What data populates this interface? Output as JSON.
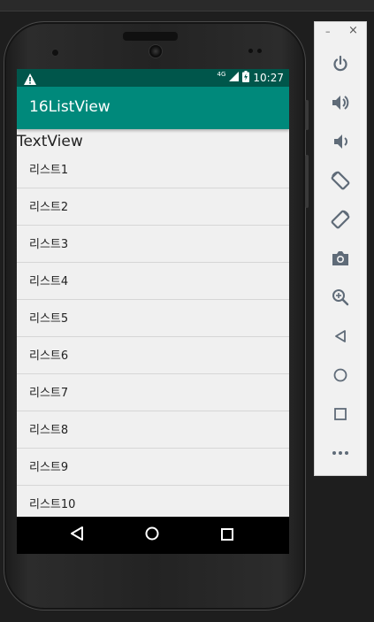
{
  "phone": {
    "status_bar": {
      "network": "4G",
      "time": "10:27"
    },
    "app_bar": {
      "title": "16ListView"
    },
    "text_view": "TextView",
    "list_items": [
      "리스트1",
      "리스트2",
      "리스트3",
      "리스트4",
      "리스트5",
      "리스트6",
      "리스트7",
      "리스트8",
      "리스트9",
      "리스트10"
    ]
  },
  "emulator_toolbar": {
    "window_controls": {
      "minimize": "–",
      "close": "×"
    },
    "buttons": [
      "power-icon",
      "volume-up-icon",
      "volume-down-icon",
      "rotate-left-icon",
      "rotate-right-icon",
      "camera-icon",
      "zoom-icon",
      "back-icon",
      "home-icon",
      "overview-icon",
      "more-icon"
    ]
  },
  "colors": {
    "status_bar": "#00564b",
    "app_bar": "#00897b",
    "background": "#1e1e1e"
  }
}
